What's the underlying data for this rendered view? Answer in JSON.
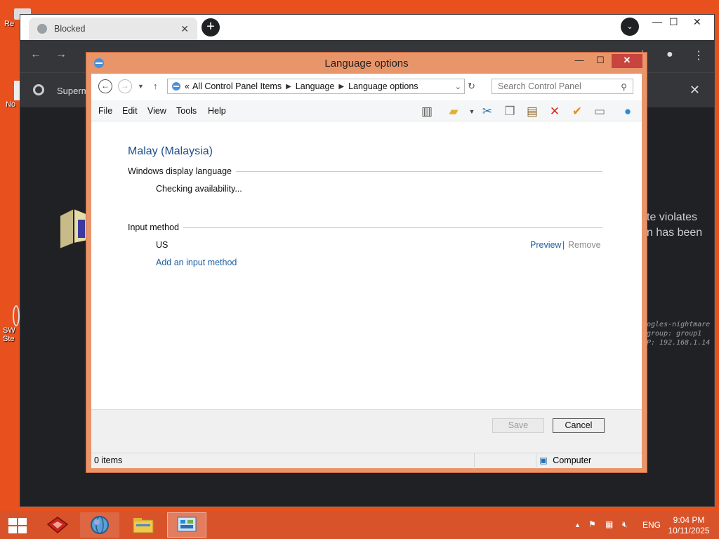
{
  "desktop": {
    "icon_labels": [
      "Re",
      "No",
      "SW",
      "Ste"
    ]
  },
  "chrome": {
    "tab_title": "Blocked",
    "banner_text": "Superm",
    "blocked_text_lines": [
      "te violates",
      "n has been"
    ],
    "blocked_mono_lines": [
      "ogles-nightmare",
      "group: group1",
      "P: 192.168.1.14"
    ]
  },
  "window": {
    "title": "Language options",
    "address": {
      "overflow": "«",
      "crumbs": [
        "All Control Panel Items",
        "Language",
        "Language options"
      ]
    },
    "search_placeholder": "Search Control Panel",
    "menu": [
      "File",
      "Edit",
      "View",
      "Tools",
      "Help"
    ],
    "toolbar_icons": [
      "layout-icon",
      "folder-options-icon",
      "cut-icon",
      "copy-icon",
      "paste-icon",
      "delete-icon",
      "properties-check-icon",
      "rename-icon",
      "help-globe-icon"
    ],
    "language_name": "Malay (Malaysia)",
    "display_language": {
      "heading": "Windows display language",
      "status": "Checking availability..."
    },
    "input_method": {
      "heading": "Input method",
      "layout": "US",
      "preview": "Preview",
      "separator": "|",
      "remove": "Remove",
      "add_link": "Add an input method"
    },
    "buttons": {
      "save": "Save",
      "cancel": "Cancel"
    },
    "status_bar": {
      "items": "0 items",
      "location": "Computer"
    }
  },
  "taskbar": {
    "language": "ENG",
    "time": "9:04 PM",
    "date": "10/11/2025"
  },
  "colors": {
    "desktop": "#e8501e",
    "taskbar": "#d9532a",
    "window_frame": "#e9956a",
    "link": "#1e5fa0",
    "heading": "#1e4e8c"
  }
}
